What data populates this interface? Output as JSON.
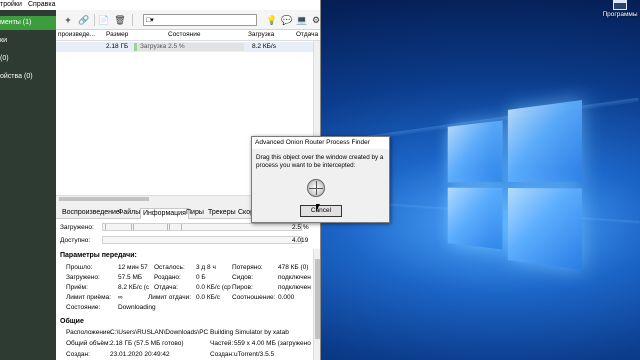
{
  "menu": {
    "items": [
      "тройки",
      "Справка"
    ]
  },
  "sidebar": {
    "items": [
      {
        "label": "менты (1)",
        "active": true
      },
      {
        "label": "ки",
        "active": false
      },
      {
        "label": "(0)",
        "active": false
      },
      {
        "label": "ойства (0)",
        "active": false
      }
    ]
  },
  "toolbar": {
    "icons": [
      "add-icon",
      "link-icon",
      "document-icon",
      "delete-icon"
    ],
    "right_icons": [
      "bulb-icon",
      "chat-icon",
      "monitor-icon",
      "gear-icon"
    ],
    "search_value": ""
  },
  "list": {
    "headers": [
      "произведе...",
      "Размер",
      "Состояние",
      "Загрузка",
      "Отдача"
    ],
    "rows": [
      {
        "size": "2.18 ГБ",
        "status": "Загрузка 2.5 %",
        "progress": 0.025,
        "down": "8.2 КБ/s",
        "up": ""
      }
    ]
  },
  "tabs": [
    "Воспроизведение",
    "Файлы",
    "Информация",
    "Пиры",
    "Трекеры",
    "Скор"
  ],
  "active_tab": "Информация",
  "bars": {
    "downloaded_label": "Загружено:",
    "downloaded_value": "2.5 %",
    "available_label": "Доступно:",
    "available_value": "4.019"
  },
  "transfer": {
    "title": "Параметры передачи:",
    "rows": [
      [
        "Прошло:",
        "12 мин 57",
        "Осталось:",
        "3 д 8 ч",
        "Потеряно:",
        "478 КБ (0)"
      ],
      [
        "Загружено:",
        "57.5 МБ",
        "Роздано:",
        "0 Б",
        "Сидов:",
        "подключен"
      ],
      [
        "Приём:",
        "8.2 КБ/с (с",
        "Отдача:",
        "0.0 КБ/с (ср",
        "Пиров:",
        "подключен"
      ],
      [
        "Лимит приёма:",
        "∞",
        "Лимит отдачи:",
        "0.0 КБ/с",
        "Соотношение:",
        "0.000"
      ],
      [
        "Состояние:",
        "Downloading",
        "",
        "",
        "",
        ""
      ]
    ]
  },
  "general": {
    "title": "Общие",
    "location_label": "Расположение:",
    "location_value": "C:\\Users\\RUSLAN\\Downloads\\PC Building Simulator by xatab",
    "total_label": "Общий объём:",
    "total_value": "2.18 ГБ (57.5 МБ готово)",
    "pieces_label": "Частей:",
    "pieces_value": "559 x 4.00 МБ (загружено",
    "created_label": "Создан:",
    "created_value": "23.01.2020 20:49:42",
    "createdby_label": "Создан:",
    "createdby_value": "uTorrent/3.5.5"
  },
  "dialog": {
    "title": "Advanced Onion Router Process Finder",
    "message": "Drag this object over the window created by a process you want to be intercepted:",
    "cancel": "Cancel"
  },
  "desktop": {
    "recycle_label": "Программы"
  }
}
